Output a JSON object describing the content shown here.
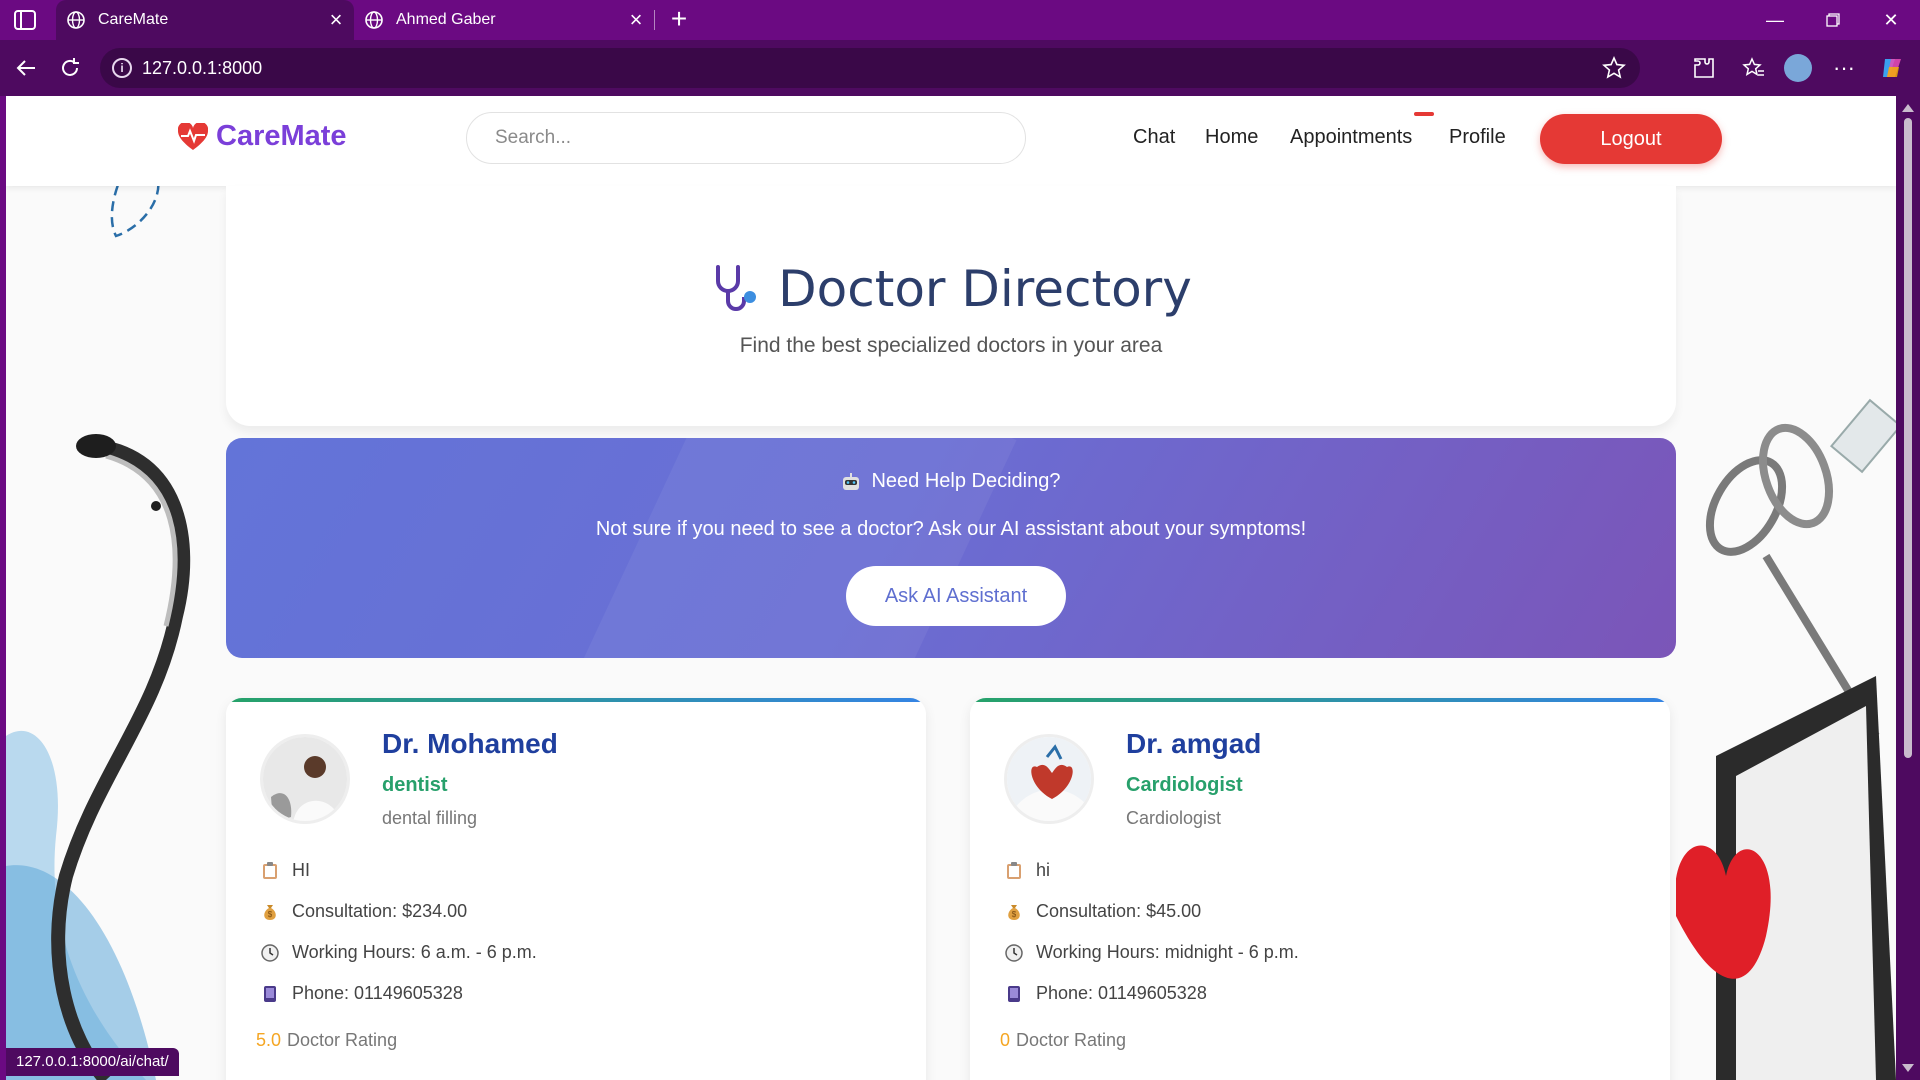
{
  "browser": {
    "tabs": [
      {
        "title": "CareMate",
        "active": true
      },
      {
        "title": "Ahmed Gaber",
        "active": false
      }
    ],
    "address": "127.0.0.1:8000",
    "status_url": "127.0.0.1:8000/ai/chat/"
  },
  "header": {
    "brand": "CareMate",
    "search_placeholder": "Search...",
    "nav": [
      "Chat",
      "Home",
      "Appointments",
      "Profile"
    ],
    "logout": "Logout"
  },
  "hero": {
    "title": "Doctor Directory",
    "subtitle": "Find the best specialized doctors in your area"
  },
  "ai": {
    "heading": "Need Help Deciding?",
    "text": "Not sure if you need to see a doctor? Ask our AI assistant about your symptoms!",
    "button": "Ask AI Assistant"
  },
  "doctors": [
    {
      "name": "Dr. Mohamed",
      "specialty": "dentist",
      "sub": "dental filling",
      "bio": "HI",
      "consultation": "Consultation: $234.00",
      "hours": "Working Hours: 6 a.m. - 6 p.m.",
      "phone": "Phone: 01149605328",
      "rating": "5.0",
      "rating_label": "Doctor Rating"
    },
    {
      "name": "Dr. amgad",
      "specialty": "Cardiologist",
      "sub": "Cardiologist",
      "bio": "hi",
      "consultation": "Consultation: $45.00",
      "hours": "Working Hours: midnight - 6 p.m.",
      "phone": "Phone: 01149605328",
      "rating": "0",
      "rating_label": "Doctor Rating"
    }
  ],
  "colors": {
    "brand": "#7b3fd9",
    "logout": "#e53935",
    "doctor_name": "#1f3f9e",
    "specialty": "#27a06b",
    "browser_frame": "#6b0a82"
  },
  "icons": [
    "globe-icon",
    "back-icon",
    "reload-icon",
    "info-icon",
    "star-icon",
    "extensions-icon",
    "favorites-icon",
    "more-icon",
    "heart-pulse-icon",
    "stethoscope-icon",
    "robot-icon",
    "clipboard-icon",
    "money-bag-icon",
    "clock-icon",
    "phone-icon"
  ]
}
